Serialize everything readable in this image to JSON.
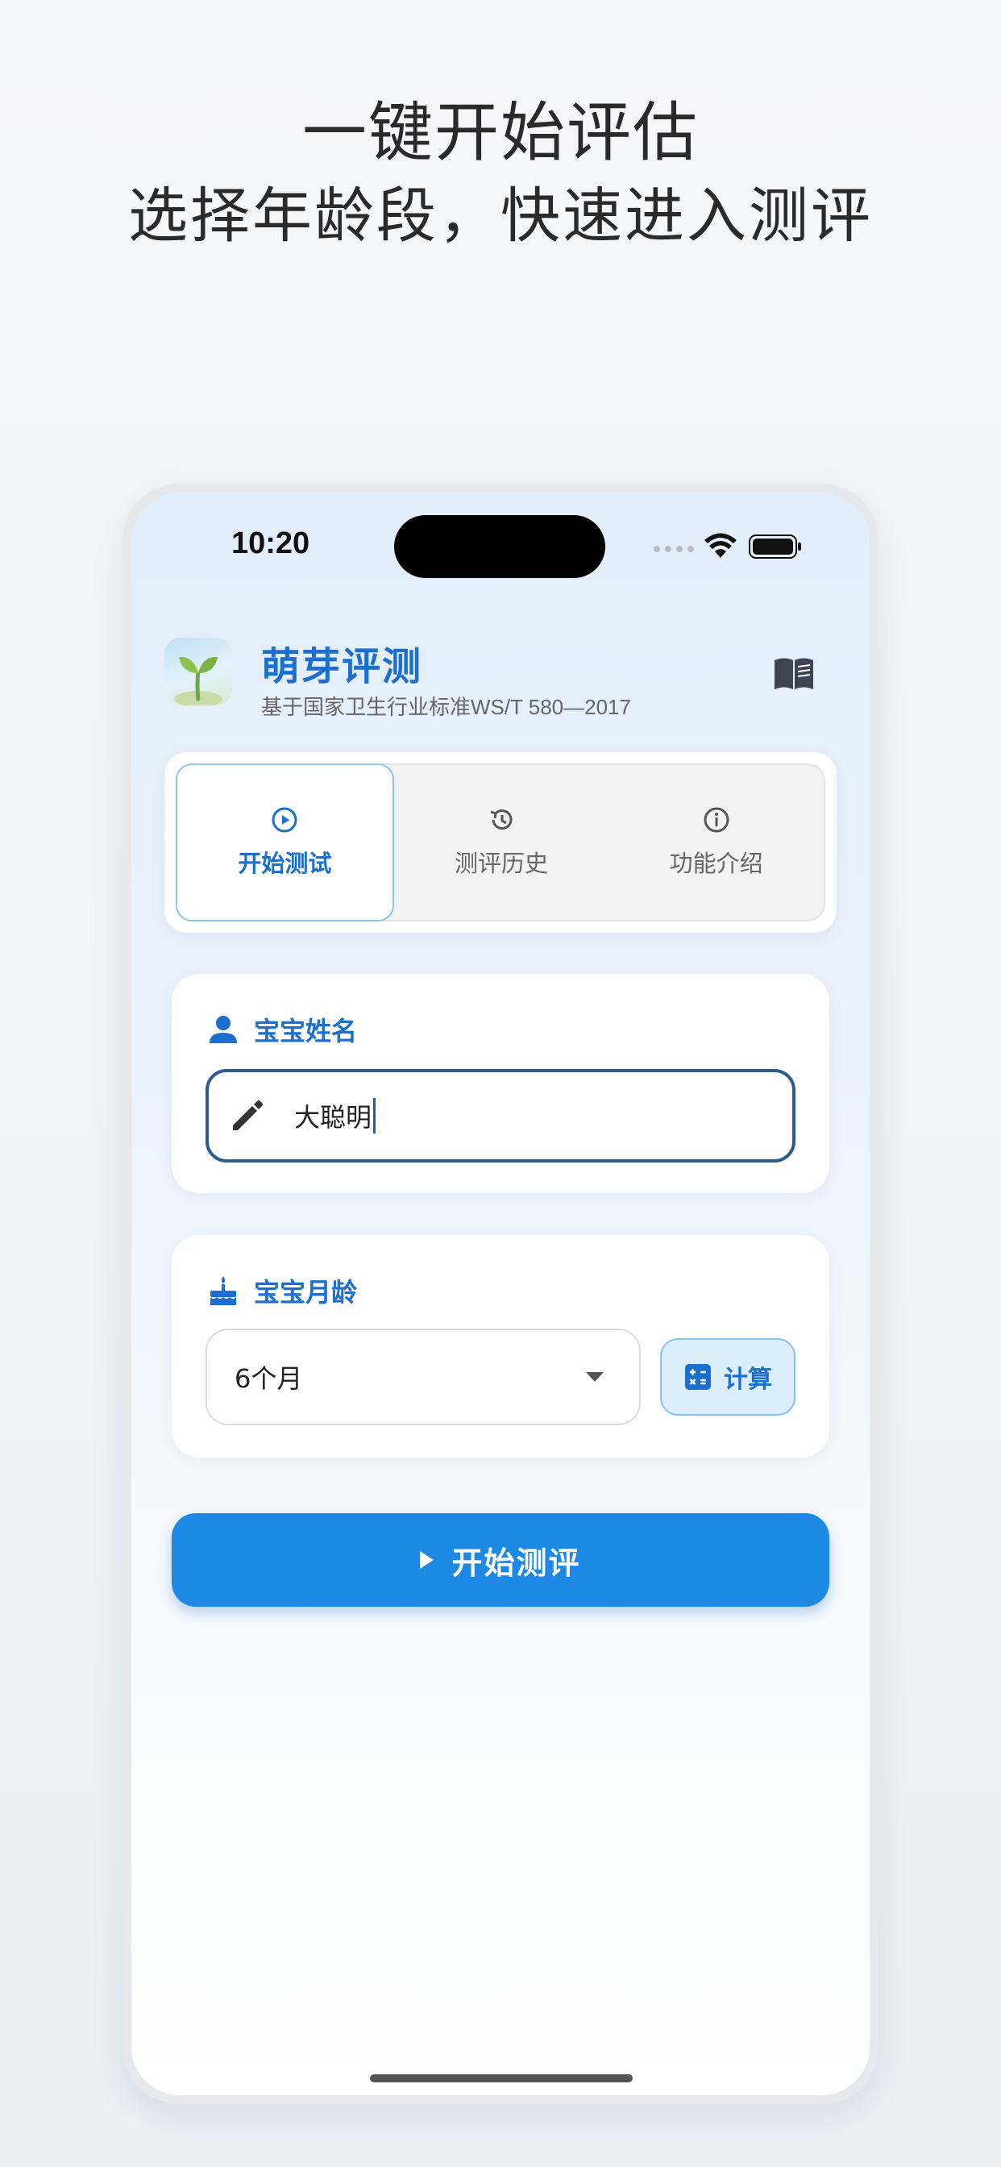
{
  "promo": {
    "title": "一键开始评估",
    "subtitle": "选择年龄段，快速进入测评"
  },
  "status_bar": {
    "time": "10:20"
  },
  "app": {
    "name": "萌芽评测",
    "subtitle": "基于国家卫生行业标准WS/T 580—2017",
    "logo_icon": "sprout-icon",
    "guide_icon": "book-icon"
  },
  "tabs": [
    {
      "label": "开始测试",
      "icon": "play-circle-icon",
      "active": true
    },
    {
      "label": "测评历史",
      "icon": "history-icon",
      "active": false
    },
    {
      "label": "功能介绍",
      "icon": "info-icon",
      "active": false
    }
  ],
  "name_card": {
    "label": "宝宝姓名",
    "icon": "person-icon",
    "input_icon": "pencil-icon",
    "value": "大聪明"
  },
  "age_card": {
    "label": "宝宝月龄",
    "icon": "cake-icon",
    "selected": "6个月",
    "calc_label": "计算",
    "calc_icon": "calculator-icon"
  },
  "start_button": {
    "label": "开始测评"
  },
  "colors": {
    "accent": "#1c6fcf",
    "button": "#1e88e5",
    "input_border": "#2a5d8e"
  }
}
